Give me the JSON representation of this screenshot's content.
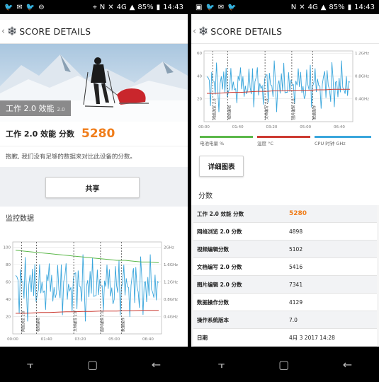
{
  "left": {
    "status": {
      "time": "14:43",
      "battery": "85%",
      "network": "4G"
    },
    "appbar": {
      "title": "SCORE DETAILS"
    },
    "hero": {
      "label": "工作 2.0 效能",
      "version": "2.0"
    },
    "score": {
      "label": "工作 2.0 效能 分数",
      "value": "5280"
    },
    "note": "抱歉, 我们没有足够的数据来对比此设备的分数。",
    "share_label": "共享",
    "monitor_title": "监控数据"
  },
  "right": {
    "status": {
      "time": "14:43",
      "battery": "85%",
      "network": "4G"
    },
    "appbar": {
      "title": "SCORE DETAILS"
    },
    "legend": [
      {
        "label": "电池电量 %",
        "color": "#5cb84a"
      },
      {
        "label": "温度 °C",
        "color": "#cc3b32"
      },
      {
        "label": "CPU 时钟 GHz",
        "color": "#3aa6dc"
      }
    ],
    "detail_label": "详细图表",
    "section_title": "分数",
    "rows": [
      {
        "key": "工作 2.0 效能 分数",
        "value": "5280"
      },
      {
        "key": "网络浏览 2.0 分数",
        "value": "4898"
      },
      {
        "key": "视频编辑分数",
        "value": "5102"
      },
      {
        "key": "文档编写 2.0 分数",
        "value": "5416"
      },
      {
        "key": "图片编辑 2.0 分数",
        "value": "7341"
      },
      {
        "key": "数据操作分数",
        "value": "4129"
      },
      {
        "key": "操作系统版本",
        "value": "7.0"
      },
      {
        "key": "日期",
        "value": "4月 3 2017 14:28"
      }
    ]
  },
  "chart_data": [
    {
      "type": "line",
      "x_ticks": [
        "00:00",
        "01:40",
        "03:20",
        "05:00",
        "06:40"
      ],
      "y_left_ticks": [
        "20",
        "40",
        "60",
        "80",
        "100"
      ],
      "y_right_ticks": [
        "0.4GHz",
        "0.8GHz",
        "1.2GHz",
        "1.6GHz",
        "2GHz"
      ],
      "markers": [
        "网络浏览 2.0",
        "视频编辑",
        "文档编写 2.0",
        "图片编辑 2.0",
        "数据操作"
      ],
      "series": [
        {
          "name": "电池电量 %",
          "color": "#5cb84a",
          "values": [
            100,
            99,
            98,
            97,
            96,
            95,
            94,
            93,
            92,
            91,
            90,
            89,
            88,
            88,
            87,
            86,
            86,
            85
          ]
        },
        {
          "name": "温度 °C",
          "color": "#cc3b32",
          "values": [
            28,
            28,
            28.5,
            29,
            29,
            29.5,
            30,
            30,
            30.5,
            30.5,
            31,
            31,
            31,
            31.5,
            31.5,
            32,
            32,
            32
          ]
        },
        {
          "name": "CPU 时钟 GHz",
          "color": "#3aa6dc",
          "values": [
            1.2,
            1.0,
            1.4,
            0.9,
            1.6,
            1.1,
            1.3,
            0.8,
            1.5,
            1.0,
            0.6,
            1.4,
            1.2,
            0.9,
            1.6,
            0.7,
            1.5,
            1.1,
            1.3,
            0.9,
            1.4,
            1.0,
            1.2,
            0.8
          ]
        }
      ]
    },
    {
      "type": "line",
      "x_ticks": [
        "00:00",
        "01:40",
        "03:20",
        "05:00",
        "06:40"
      ],
      "y_left_ticks": [
        "20",
        "40",
        "60"
      ],
      "y_right_ticks": [
        "0.4GHz",
        "0.8GHz",
        "1.2GHz"
      ],
      "markers": [
        "网络浏览 2.0",
        "视频编辑",
        "文档编写 2.0",
        "图片编辑 2.0",
        "数据操作"
      ]
    }
  ]
}
